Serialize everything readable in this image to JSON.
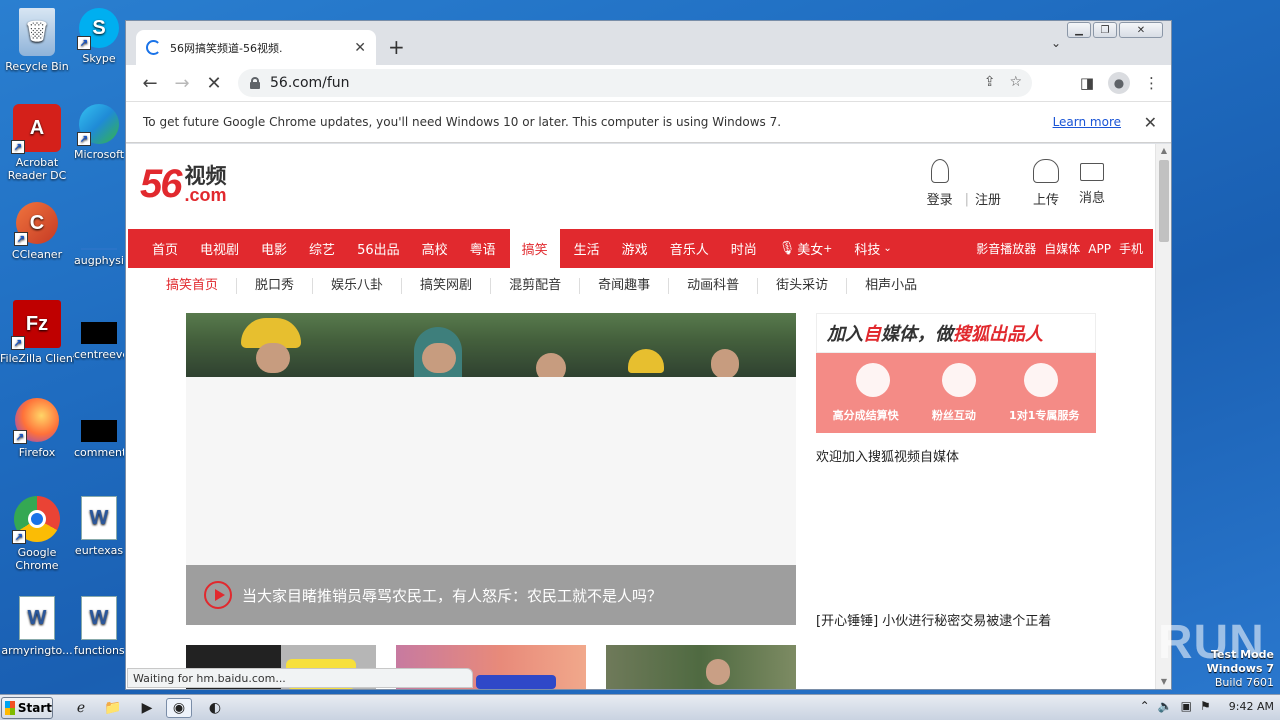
{
  "desktop": {
    "icons": [
      {
        "label": "Recycle Bin",
        "icon": "recycle-bin-icon",
        "color": "#8fb3d9"
      },
      {
        "label": "Skype",
        "icon": "skype-icon",
        "color": "#00aff0"
      },
      {
        "label": "Acrobat Reader DC",
        "icon": "acrobat-icon",
        "color": "#d4201a"
      },
      {
        "label": "Microsoft",
        "icon": "edge-icon",
        "color": "#1f8bd6"
      },
      {
        "label": "CCleaner",
        "icon": "ccleaner-icon",
        "color": "#d84b2a"
      },
      {
        "label": "augphysic",
        "icon": "file-icon",
        "color": "#2a74c8"
      },
      {
        "label": "FileZilla Client",
        "icon": "filezilla-icon",
        "color": "#bf0000"
      },
      {
        "label": "centreeve",
        "icon": "blank-file-icon",
        "color": "#000000"
      },
      {
        "label": "Firefox",
        "icon": "firefox-icon",
        "color": "#ff7139"
      },
      {
        "label": "commentb",
        "icon": "blank-file-icon",
        "color": "#000000"
      },
      {
        "label": "Google Chrome",
        "icon": "chrome-icon",
        "color": "#1a73e8"
      },
      {
        "label": "eurtexas",
        "icon": "word-doc-icon",
        "color": "#2b579a"
      },
      {
        "label": "armyringto...",
        "icon": "word-doc-icon",
        "color": "#2b579a"
      },
      {
        "label": "functions",
        "icon": "word-doc-icon",
        "color": "#2b579a"
      }
    ]
  },
  "browser": {
    "tab_title": "56网搞笑频道-56视频.",
    "url": "56.com/fun",
    "infobar_text": "To get future Google Chrome updates, you'll need Windows 10 or later. This computer is using Windows 7.",
    "infobar_link": "Learn more",
    "status_text": "Waiting for hm.baidu.com..."
  },
  "site": {
    "logo_num": "56",
    "logo_cn": "视频",
    "logo_com": ".com",
    "accent": "#e1292e",
    "user_actions": {
      "login": "登录",
      "register": "注册",
      "upload": "上传",
      "messages": "消息"
    },
    "main_nav": [
      "首页",
      "电视剧",
      "电影",
      "综艺",
      "56出品",
      "高校",
      "粤语",
      "搞笑",
      "生活",
      "游戏",
      "音乐人",
      "时尚",
      "美女",
      "科技"
    ],
    "main_nav_active": "搞笑",
    "nav_right": [
      "影音播放器",
      "自媒体",
      "APP",
      "手机"
    ],
    "sub_nav": [
      "搞笑首页",
      "脱口秀",
      "娱乐八卦",
      "搞笑网剧",
      "混剪配音",
      "奇闻趣事",
      "动画科普",
      "街头采访",
      "相声小品"
    ],
    "main_caption": "当大家目睹推销员辱骂农民工，有人怒斥：农民工就不是人吗？",
    "ad_title_parts": [
      "加入",
      "自",
      "媒体，做",
      "搜狐出品人"
    ],
    "ad_features": [
      "高分成结算快",
      "粉丝互动",
      "1对1专属服务"
    ],
    "side_text_1": "欢迎加入搜狐视频自媒体",
    "side_text_2": "[开心锤锤] 小伙进行秘密交易被逮个正着"
  },
  "overlay": {
    "watermark": "ANY RUN",
    "test_mode": "Test Mode",
    "os": "Windows 7",
    "build": "Build 7601"
  },
  "taskbar": {
    "start_label": "Start",
    "clock": "9:42 AM"
  }
}
